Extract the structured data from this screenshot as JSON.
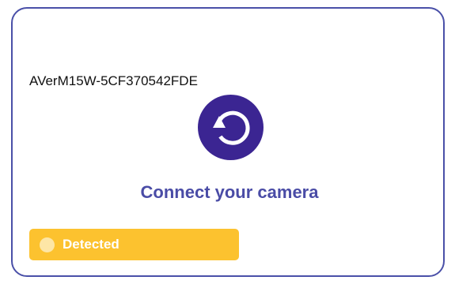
{
  "camera": {
    "device_name": "AVerM15W-5CF370542FDE"
  },
  "connect": {
    "title": "Connect your camera",
    "refresh_icon": "refresh-icon"
  },
  "status": {
    "label": "Detected",
    "dot_icon": "status-dot-icon"
  },
  "colors": {
    "card_border": "#4a50a8",
    "accent_purple": "#3b2592",
    "title_color": "#4a4ca6",
    "status_yellow": "#fcc22f"
  }
}
